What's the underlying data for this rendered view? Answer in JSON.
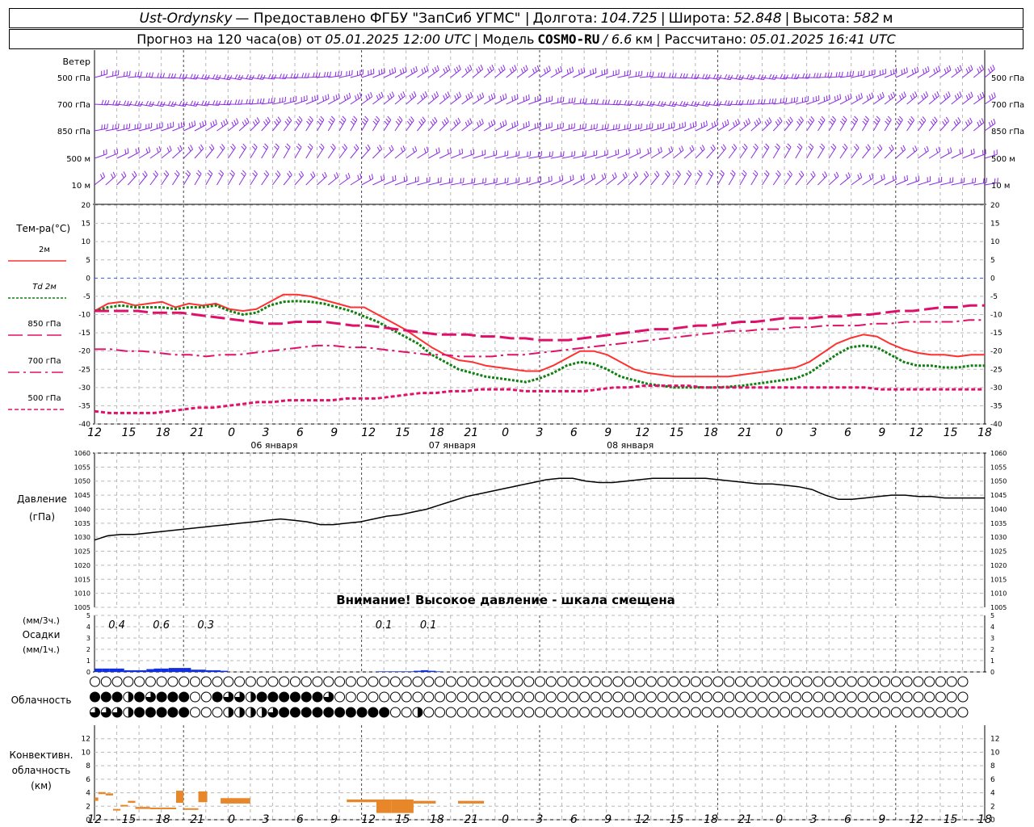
{
  "header": {
    "station": "Ust-Ordynsky",
    "provided_by": "— Предоставлено ФГБУ \"ЗапСиб УГМС\" |",
    "lon_label": "Долгота:",
    "lon_value": "104.725",
    "sep1": "|",
    "lat_label": "Широта:",
    "lat_value": "52.848",
    "sep2": "|",
    "alt_label": "Высота:",
    "alt_value": "582",
    "alt_unit": "м",
    "forecast_label": "Прогноз на 120 часа(ов)  от",
    "forecast_time": "05.01.2025 12:00 UTC",
    "model_label": " | Модель",
    "model_name": "COSMO-RU",
    "model_res": "/ 6.6",
    "model_res_unit": "км",
    "calc_label": " | Рассчитано:",
    "calc_time": "05.01.2025 16:41 UTC"
  },
  "wind_panel": {
    "title": "Ветер",
    "levels": [
      "500 гПа",
      "700 гПа",
      "850 гПа",
      "500 м",
      "10  м"
    ],
    "right_levels": [
      "500 гПа",
      "700 гПа",
      "850 гПа",
      "500 м",
      "10  м"
    ]
  },
  "temp_panel": {
    "title": "Тем-ра(°С)",
    "legend": [
      {
        "label": "2м",
        "color": "#ff3030",
        "dash": "solid"
      },
      {
        "label": "Td  2м",
        "color": "#108010",
        "dash": "dot"
      },
      {
        "label": "850 гПа",
        "color": "#e0106a",
        "dash": "longdash"
      },
      {
        "label": "700 гПа",
        "color": "#e0106a",
        "dash": "dashdot"
      },
      {
        "label": "500 гПа",
        "color": "#e0106a",
        "dash": "shortdash"
      }
    ]
  },
  "pressure_panel": {
    "title": "Давление",
    "unit": "(гПа)",
    "warning": "Внимание! Высокое давление - шкала смещена"
  },
  "precip_panel": {
    "unit_3h": "(мм/3ч.)",
    "title": "Осадки",
    "unit_1h": "(мм/1ч.)",
    "labels": [
      {
        "h": 3,
        "text": "0.4"
      },
      {
        "h": 9,
        "text": "0.6"
      },
      {
        "h": 15,
        "text": "0.3"
      },
      {
        "h": 39,
        "text": "0.1"
      },
      {
        "h": 45,
        "text": "0.1"
      }
    ]
  },
  "cloud_panel": {
    "title": "Облачность"
  },
  "conv_panel": {
    "title": "Конвективн.",
    "title2": "облачность",
    "unit": "(км)"
  },
  "time_axis": {
    "hour_labels": [
      "12",
      "15",
      "18",
      "21",
      "0",
      "3",
      "6",
      "9",
      "12",
      "15",
      "18",
      "21",
      "0",
      "3",
      "6",
      "9",
      "12",
      "15",
      "18",
      "21",
      "0",
      "3",
      "6",
      "9",
      "12",
      "15",
      "18"
    ],
    "date_labels": [
      {
        "h": 24,
        "text": "06 января"
      },
      {
        "h": 48,
        "text": "07 января"
      },
      {
        "h": 72,
        "text": "08 января"
      }
    ]
  },
  "colors": {
    "t2m": "#ff3030",
    "td2m": "#108010",
    "upper": "#e0106a",
    "pressure": "#000000",
    "precip": "#1030e0",
    "conv": "#e8862a",
    "wind": "#8a2be2",
    "grid": "#b8b8b8",
    "zero_line": "#3050ff"
  },
  "chart_data": [
    {
      "type": "line",
      "xlabel": "",
      "ylabel": "Тем-ра(°С)",
      "ylim": [
        -40,
        20
      ],
      "yticks": [
        -40,
        -35,
        -30,
        -25,
        -20,
        -15,
        -10,
        -5,
        0,
        5,
        10,
        15,
        20
      ],
      "x_hours_from_start": [
        0,
        2,
        4,
        6,
        8,
        10,
        12,
        14,
        16,
        18,
        20,
        22,
        24,
        26,
        28,
        30,
        32,
        34,
        36,
        38,
        40,
        42,
        44,
        46,
        48,
        50,
        52,
        54,
        56,
        58,
        60,
        62,
        64,
        66,
        68,
        70,
        72,
        74,
        76,
        78,
        80,
        82,
        84,
        86,
        88,
        90,
        92,
        94,
        96,
        98,
        100,
        102,
        104,
        106,
        108,
        110,
        112,
        114,
        116,
        118,
        120
      ],
      "series": [
        {
          "name": "2м",
          "values": [
            -9,
            -7,
            -6.5,
            -7.5,
            -7,
            -6.5,
            -8,
            -7,
            -7.5,
            -7,
            -8.5,
            -9,
            -8.5,
            -6.5,
            -4.5,
            -4.5,
            -5,
            -6,
            -7,
            -8,
            -8,
            -10,
            -12,
            -14,
            -16.5,
            -19,
            -21,
            -22.5,
            -23,
            -24,
            -24.5,
            -25,
            -25.5,
            -25.5,
            -24,
            -22,
            -20,
            -20,
            -21,
            -23,
            -25,
            -26,
            -26.5,
            -27,
            -27,
            -27,
            -27,
            -27,
            -26.5,
            -26,
            -25.5,
            -25,
            -24.5,
            -23,
            -20.5,
            -18,
            -16.5,
            -15.5,
            -16,
            -18,
            -19.5,
            -20.5,
            -21,
            -21,
            -21.5,
            -21,
            -21
          ]
        },
        {
          "name": "Td  2м",
          "values": [
            -9,
            -8,
            -7.5,
            -8,
            -8,
            -8,
            -8.5,
            -8,
            -8,
            -7.5,
            -9,
            -10,
            -9.5,
            -7.5,
            -6.5,
            -6.3,
            -6.5,
            -7,
            -8,
            -9,
            -10.5,
            -12,
            -14,
            -16,
            -18,
            -21,
            -23,
            -25,
            -26,
            -27,
            -27.5,
            -28,
            -28.5,
            -27.5,
            -26,
            -24,
            -23,
            -23.5,
            -25,
            -27,
            -28,
            -29,
            -29.5,
            -30,
            -30,
            -30,
            -30,
            -29.8,
            -29.5,
            -29,
            -28.5,
            -28,
            -27.5,
            -26,
            -23.5,
            -21,
            -19,
            -18.5,
            -19,
            -21,
            -23,
            -24,
            -24,
            -24.5,
            -24.5,
            -24,
            -24
          ]
        },
        {
          "name": "850 гПа",
          "values": [
            -9,
            -9,
            -9,
            -9,
            -9.5,
            -9.5,
            -9.5,
            -10,
            -10.5,
            -11,
            -11.5,
            -12,
            -12.5,
            -12.5,
            -12,
            -12,
            -12,
            -12.5,
            -13,
            -13,
            -13.5,
            -14,
            -14.5,
            -15,
            -15.5,
            -15.5,
            -15.5,
            -16,
            -16,
            -16.5,
            -16.5,
            -17,
            -17,
            -17,
            -16.5,
            -16,
            -15.5,
            -15,
            -14.5,
            -14,
            -14,
            -13.5,
            -13,
            -13,
            -12.5,
            -12,
            -12,
            -11.5,
            -11,
            -11,
            -11,
            -10.5,
            -10.5,
            -10,
            -10,
            -9.5,
            -9,
            -9,
            -8.5,
            -8,
            -8,
            -7.5,
            -7.5
          ]
        },
        {
          "name": "700 гПа",
          "values": [
            -19.5,
            -19.5,
            -20,
            -20,
            -20.5,
            -21,
            -21,
            -21.5,
            -21,
            -21,
            -20.5,
            -20,
            -19.5,
            -19,
            -18.5,
            -18.5,
            -19,
            -19,
            -19.5,
            -20,
            -20.5,
            -21,
            -21,
            -21.5,
            -21.5,
            -21.5,
            -21,
            -21,
            -20.5,
            -20,
            -19.5,
            -19,
            -18.5,
            -18,
            -17.5,
            -17,
            -16.5,
            -16,
            -15.5,
            -15,
            -14.5,
            -14.5,
            -14,
            -14,
            -13.5,
            -13.5,
            -13,
            -13,
            -13,
            -12.5,
            -12.5,
            -12,
            -12,
            -12,
            -12,
            -11.5,
            -11.5
          ]
        },
        {
          "name": "500 гПа",
          "values": [
            -36.5,
            -37,
            -37,
            -37,
            -37,
            -36.5,
            -36,
            -35.5,
            -35.5,
            -35,
            -34.5,
            -34,
            -34,
            -33.5,
            -33.5,
            -33.5,
            -33.5,
            -33,
            -33,
            -33,
            -32.5,
            -32,
            -31.5,
            -31.5,
            -31,
            -31,
            -30.5,
            -30.5,
            -30.5,
            -31,
            -31,
            -31,
            -31,
            -31,
            -30.5,
            -30,
            -30,
            -29.5,
            -29.5,
            -29.5,
            -29.5,
            -30,
            -30,
            -30,
            -30,
            -30,
            -30,
            -30,
            -30,
            -30,
            -30,
            -30,
            -30,
            -30.5,
            -30.5,
            -30.5,
            -30.5,
            -30.5,
            -30.5,
            -30.5,
            -30.5
          ]
        }
      ]
    },
    {
      "type": "line",
      "ylabel": "Давление (гПа)",
      "ylim": [
        1005,
        1060
      ],
      "yticks": [
        1005,
        1010,
        1015,
        1020,
        1025,
        1030,
        1035,
        1040,
        1045,
        1050,
        1055,
        1060
      ],
      "x_hours_from_start": [
        0,
        2,
        4,
        6,
        8,
        10,
        12,
        14,
        16,
        18,
        20,
        22,
        24,
        26,
        28,
        30,
        32,
        34,
        36,
        38,
        40,
        42,
        44,
        46,
        48,
        50,
        52,
        54,
        56,
        58,
        60,
        62,
        64,
        66,
        68,
        70,
        72,
        74,
        76,
        78,
        80,
        82,
        84,
        86,
        88,
        90,
        92,
        94,
        96,
        98,
        100,
        102,
        104,
        106,
        108,
        110,
        112,
        114,
        116,
        118,
        120
      ],
      "series": [
        {
          "name": "Давление",
          "values": [
            1029,
            1030.5,
            1031,
            1031,
            1031.5,
            1032,
            1032.5,
            1033,
            1033.5,
            1034,
            1034.5,
            1035,
            1035.5,
            1036,
            1036.5,
            1036,
            1035.5,
            1034.5,
            1034.5,
            1035,
            1035.5,
            1036.5,
            1037.5,
            1038,
            1039,
            1040,
            1041.5,
            1043,
            1044.5,
            1045.5,
            1046.5,
            1047.5,
            1048.5,
            1049.5,
            1050.5,
            1051,
            1051,
            1050,
            1049.5,
            1049.5,
            1050,
            1050.5,
            1051,
            1051,
            1051,
            1051,
            1051,
            1050.5,
            1050,
            1049.5,
            1049,
            1049,
            1048.5,
            1048,
            1047,
            1045,
            1043.5,
            1043.5,
            1044,
            1044.5,
            1045,
            1045,
            1044.5,
            1044.5,
            1044,
            1044,
            1044,
            1044
          ]
        }
      ]
    },
    {
      "type": "bar",
      "ylabel": "Осадки (мм/1ч.)",
      "ylim": [
        0,
        5
      ],
      "x_hours_from_start": [
        1,
        2,
        3,
        4,
        5,
        6,
        7,
        8,
        9,
        10,
        11,
        12,
        13,
        14,
        15,
        16,
        17,
        18,
        39,
        40,
        41,
        42,
        43,
        44,
        45,
        46,
        47
      ],
      "values": [
        0.3,
        0.3,
        0.3,
        0.3,
        0.15,
        0.15,
        0.15,
        0.25,
        0.3,
        0.3,
        0.35,
        0.35,
        0.35,
        0.2,
        0.2,
        0.15,
        0.15,
        0.1,
        0.05,
        0.05,
        0.05,
        0.05,
        0.05,
        0.1,
        0.15,
        0.1,
        0.05
      ]
    },
    {
      "type": "bar",
      "ylabel": "Конвективн. облачность (км)",
      "ylim": [
        0,
        13
      ],
      "yticks": [
        0,
        2,
        4,
        6,
        8,
        10,
        12
      ],
      "segments": [
        {
          "x0": 0,
          "x1": 0.5,
          "base": 2.8,
          "top": 3.3
        },
        {
          "x0": 0.5,
          "x1": 1.5,
          "base": 3.8,
          "top": 4.1
        },
        {
          "x0": 1.5,
          "x1": 2.5,
          "base": 3.6,
          "top": 3.9
        },
        {
          "x0": 2.5,
          "x1": 3.5,
          "base": 1.4,
          "top": 1.6
        },
        {
          "x0": 3.5,
          "x1": 4.5,
          "base": 2.0,
          "top": 2.2
        },
        {
          "x0": 4.5,
          "x1": 5.5,
          "base": 2.5,
          "top": 2.8
        },
        {
          "x0": 5.5,
          "x1": 7.5,
          "base": 1.6,
          "top": 1.9
        },
        {
          "x0": 7.5,
          "x1": 9,
          "base": 1.6,
          "top": 1.8
        },
        {
          "x0": 9,
          "x1": 11,
          "base": 1.6,
          "top": 1.8
        },
        {
          "x0": 11,
          "x1": 12,
          "base": 2.5,
          "top": 4.3
        },
        {
          "x0": 12,
          "x1": 14,
          "base": 1.5,
          "top": 1.7
        },
        {
          "x0": 14,
          "x1": 15.2,
          "base": 2.6,
          "top": 4.2
        },
        {
          "x0": 17,
          "x1": 19,
          "base": 2.4,
          "top": 3.2
        },
        {
          "x0": 19,
          "x1": 21,
          "base": 2.4,
          "top": 3.2
        },
        {
          "x0": 34,
          "x1": 38,
          "base": 2.6,
          "top": 3.0
        },
        {
          "x0": 38,
          "x1": 40,
          "base": 1.0,
          "top": 3.0
        },
        {
          "x0": 40,
          "x1": 43,
          "base": 1.0,
          "top": 3.0
        },
        {
          "x0": 43,
          "x1": 46,
          "base": 2.4,
          "top": 2.8
        },
        {
          "x0": 49,
          "x1": 52.5,
          "base": 2.4,
          "top": 2.8
        }
      ]
    }
  ],
  "clouds": {
    "row1": "0000000000000000000000000000000000000000000000000000000000000000000000000000000",
    "row2": "4442434440043324444443000000000000000000000000000000000000000000000000000000000",
    "row3": "3332444440002222344444444440020000000000000000000000000000000000000000000000000"
  }
}
